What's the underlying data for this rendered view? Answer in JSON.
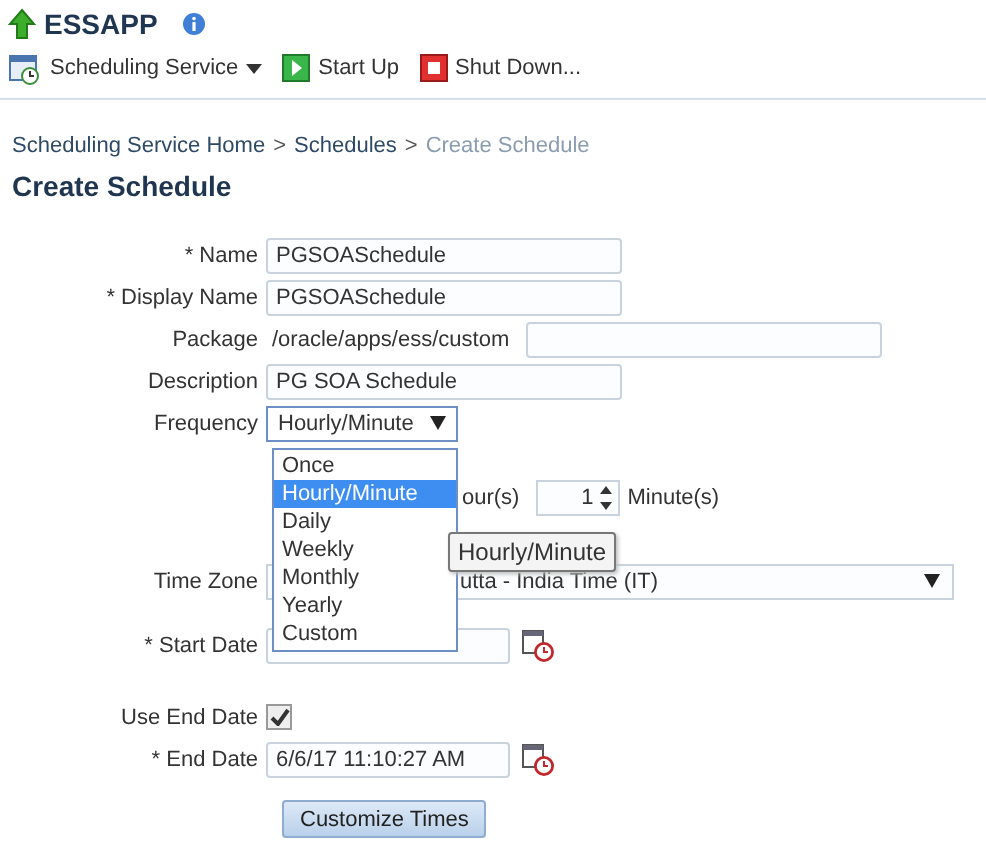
{
  "app": {
    "title": "ESSAPP"
  },
  "toolbar": [
    {
      "kind": "menu",
      "label": "Scheduling Service"
    },
    {
      "kind": "start",
      "label": "Start Up"
    },
    {
      "kind": "stop",
      "label": "Shut Down..."
    }
  ],
  "breadcrumb": [
    {
      "kind": "link",
      "label": "Scheduling Service Home",
      "current": false
    },
    {
      "kind": "sep",
      "label": ">"
    },
    {
      "kind": "link",
      "label": "Schedules",
      "current": false
    },
    {
      "kind": "sep",
      "label": ">"
    },
    {
      "kind": "link",
      "label": "Create Schedule",
      "current": true
    }
  ],
  "page_title": "Create Schedule",
  "form": [
    {
      "kind": "text",
      "label": "* Name",
      "value": "PGSOASchedule"
    },
    {
      "kind": "text",
      "label": "* Display Name",
      "value": "PGSOASchedule"
    },
    {
      "kind": "package",
      "label": "Package",
      "value": "/oracle/apps/ess/custom"
    },
    {
      "kind": "text",
      "label": "Description",
      "value": "PG SOA Schedule"
    },
    {
      "kind": "select",
      "label": "Frequency",
      "value": "Hourly/Minute",
      "expanded": true
    },
    {
      "kind": "repeat",
      "hours_label": "our(s)",
      "minutes_value": "1",
      "minutes_label": "Minute(s)"
    },
    {
      "kind": "timezone",
      "label": "Time Zone",
      "value": "utta - India Time (IT)"
    },
    {
      "kind": "date",
      "label": "* Start Date"
    },
    {
      "kind": "checkbox",
      "label": "Use End Date",
      "checked": true
    },
    {
      "kind": "date",
      "label": "* End Date",
      "value": "6/6/17 11:10:27 AM"
    },
    {
      "kind": "button",
      "label": "Customize Times"
    }
  ],
  "frequency_options": [
    {
      "label": "Once",
      "selected": false
    },
    {
      "label": "Hourly/Minute",
      "selected": true
    },
    {
      "label": "Daily",
      "selected": false
    },
    {
      "label": "Weekly",
      "selected": false
    },
    {
      "label": "Monthly",
      "selected": false
    },
    {
      "label": "Yearly",
      "selected": false
    },
    {
      "label": "Custom",
      "selected": false
    }
  ],
  "tooltip": "Hourly/Minute"
}
